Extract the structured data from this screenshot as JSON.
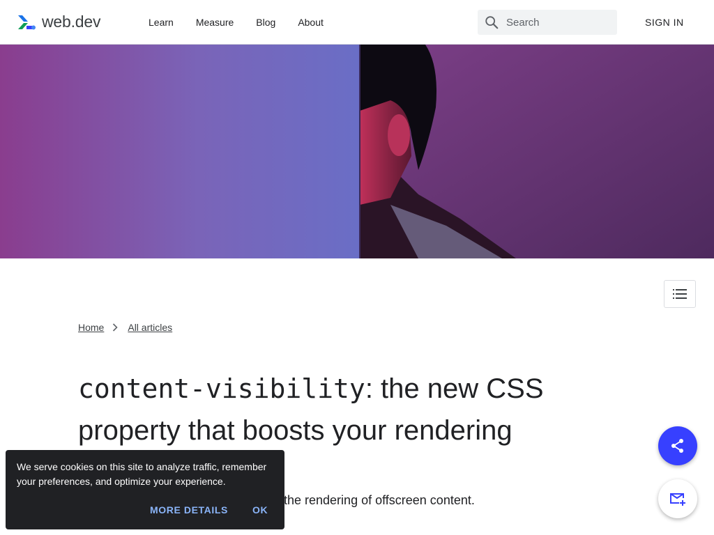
{
  "header": {
    "logo_text": "web.dev",
    "nav": [
      "Learn",
      "Measure",
      "Blog",
      "About"
    ],
    "search_placeholder": "Search",
    "sign_in": "SIGN IN"
  },
  "breadcrumb": {
    "home": "Home",
    "all_articles": "All articles"
  },
  "article": {
    "title_code": "content-visibility",
    "title_rest": ": the new CSS property that boosts your rendering",
    "subtitle": "the rendering of offscreen content."
  },
  "cookie_banner": {
    "text": "We serve cookies on this site to analyze traffic, remember your preferences, and optimize your experience.",
    "more_details": "MORE DETAILS",
    "ok": "OK"
  },
  "icons": {
    "logo": "webdev-logo-icon",
    "search": "search-icon",
    "toc": "table-of-contents-icon",
    "breadcrumb_separator": "chevron-right-icon",
    "share": "share-icon",
    "subscribe": "mail-plus-icon"
  },
  "colors": {
    "brand_blue": "#3740ff",
    "cookie_bg": "#202124",
    "cookie_link": "#8ab4f8"
  }
}
